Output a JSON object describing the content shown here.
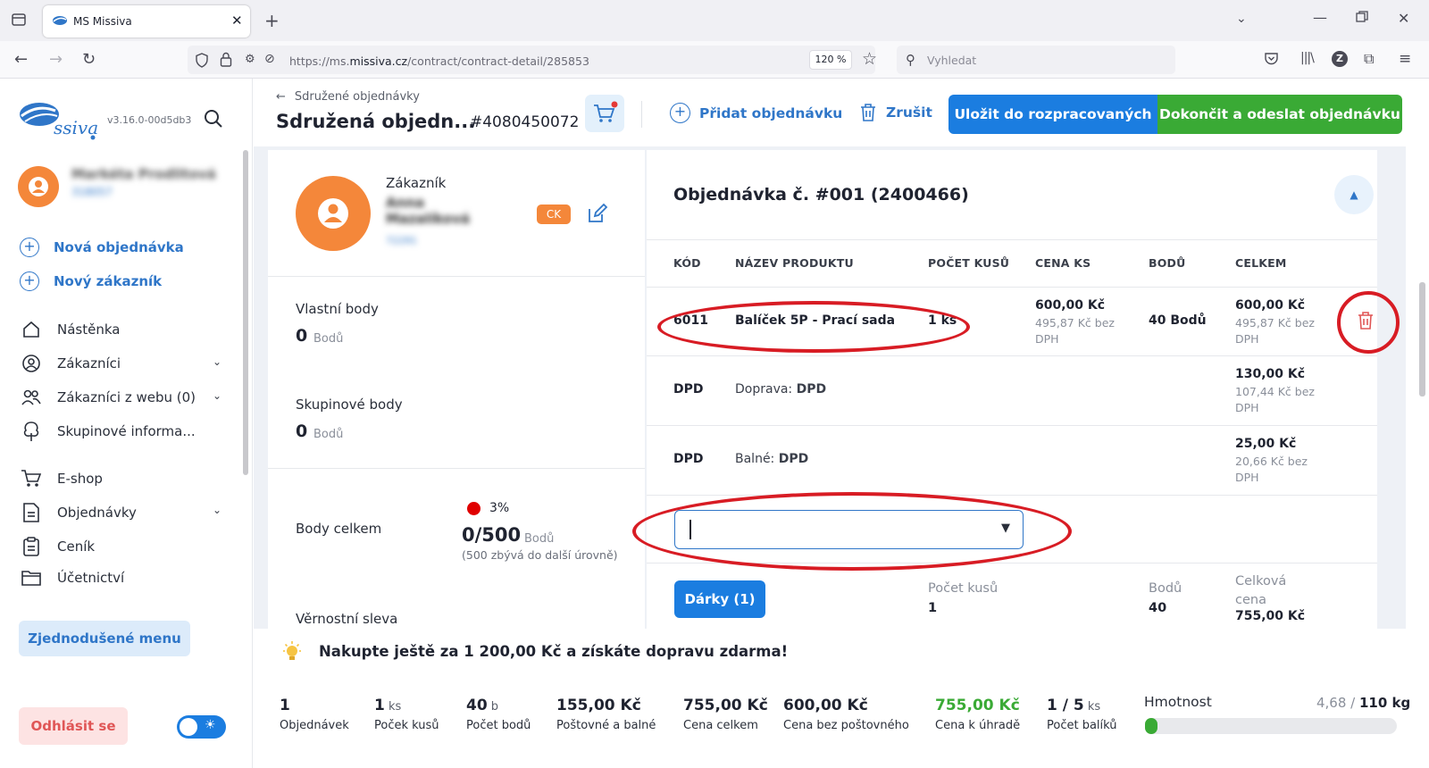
{
  "browser": {
    "tab_title": "MS Missiva",
    "url_prefix": "https://ms.",
    "url_domain": "missiva.cz",
    "url_path": "/contract/contract-detail/285853",
    "zoom": "120 %",
    "search_placeholder": "Vyhledat"
  },
  "sidebar": {
    "version": "v3.16.0-00d5db3",
    "user_name": "Markéta Prodlitová",
    "user_id": "318057",
    "new_order": "Nová objednávka",
    "new_customer": "Nový zákazník",
    "items": [
      "Nástěnka",
      "Zákazníci",
      "Zákazníci z webu (0)",
      "Skupinové informa...",
      "E-shop",
      "Objednávky",
      "Ceník",
      "Účetnictví"
    ],
    "simplified_menu": "Zjednodušené menu",
    "logout": "Odhlásit se"
  },
  "header": {
    "back_label": "Sdružené objednávky",
    "title": "Sdružená objedn...",
    "order_number": "#4080450072",
    "add_order": "Přidat objednávku",
    "cancel": "Zrušit",
    "save_draft": "Uložit do rozpracovaných",
    "finish": "Dokončit a odeslat objednávku"
  },
  "customer": {
    "label": "Zákazník",
    "name_line1": "Anna",
    "name_line2": "Mazalíková",
    "id": "72291",
    "badge": "CK",
    "own_points_label": "Vlastní body",
    "own_points_value": "0",
    "group_points_label": "Skupinové body",
    "group_points_value": "0",
    "points_unit": "Bodů",
    "total_points_label": "Body celkem",
    "total_percent": "3%",
    "total_points_value": "0/500",
    "total_points_note": "(500 zbývá do další úrovně)",
    "loyalty_label": "Věrnostní sleva"
  },
  "order": {
    "title": "Objednávka č. #001 (2400466)",
    "columns": [
      "KÓD",
      "NÁZEV PRODUKTU",
      "POČET KUSŮ",
      "CENA KS",
      "BODŮ",
      "CELKEM"
    ],
    "product": {
      "code": "6011",
      "name": "Balíček 5P - Prací sada",
      "qty": "1 ks",
      "price": "600,00 Kč",
      "price_sub": "495,87 Kč bez DPH",
      "points": "40 Bodů",
      "total": "600,00 Kč",
      "total_sub": "495,87 Kč bez DPH"
    },
    "shipping": {
      "code": "DPD",
      "label": "Doprava:",
      "value": "DPD",
      "total": "130,00 Kč",
      "total_sub": "107,44 Kč bez DPH"
    },
    "packing": {
      "code": "DPD",
      "label": "Balné:",
      "value": "DPD",
      "total": "25,00 Kč",
      "total_sub": "20,66 Kč bez DPH"
    },
    "gifts_button": "Dárky (1)",
    "summary_qty_label": "Počet kusů",
    "summary_qty": "1",
    "summary_points_label": "Bodů",
    "summary_points": "40",
    "summary_total_label": "Celková cena",
    "summary_total": "755,00 Kč"
  },
  "footer": {
    "promo": "Nakupte ještě za 1 200,00 Kč a získáte dopravu zdarma!",
    "stats": [
      {
        "value": "1",
        "unit": "",
        "label": "Objednávek"
      },
      {
        "value": "1",
        "unit": "ks",
        "label": "Poček kusů"
      },
      {
        "value": "40",
        "unit": "b",
        "label": "Počet bodů"
      },
      {
        "value": "155,00 Kč",
        "unit": "",
        "label": "Poštovné a balné"
      },
      {
        "value": "755,00 Kč",
        "unit": "",
        "label": "Cena celkem"
      },
      {
        "value": "600,00 Kč",
        "unit": "",
        "label": "Cena bez poštovného"
      },
      {
        "value": "755,00 Kč",
        "unit": "",
        "label": "Cena k úhradě"
      },
      {
        "value": "1 / 5",
        "unit": "ks",
        "label": "Počet balíků"
      }
    ],
    "weight_label": "Hmotnost",
    "weight_current": "4,68",
    "weight_max": "110 kg",
    "weight_fraction": 0.04
  },
  "colors": {
    "accent_blue": "#1b7de0",
    "accent_green": "#3aaa35",
    "orange": "#f4873a",
    "annotation_red": "#d81c24"
  }
}
